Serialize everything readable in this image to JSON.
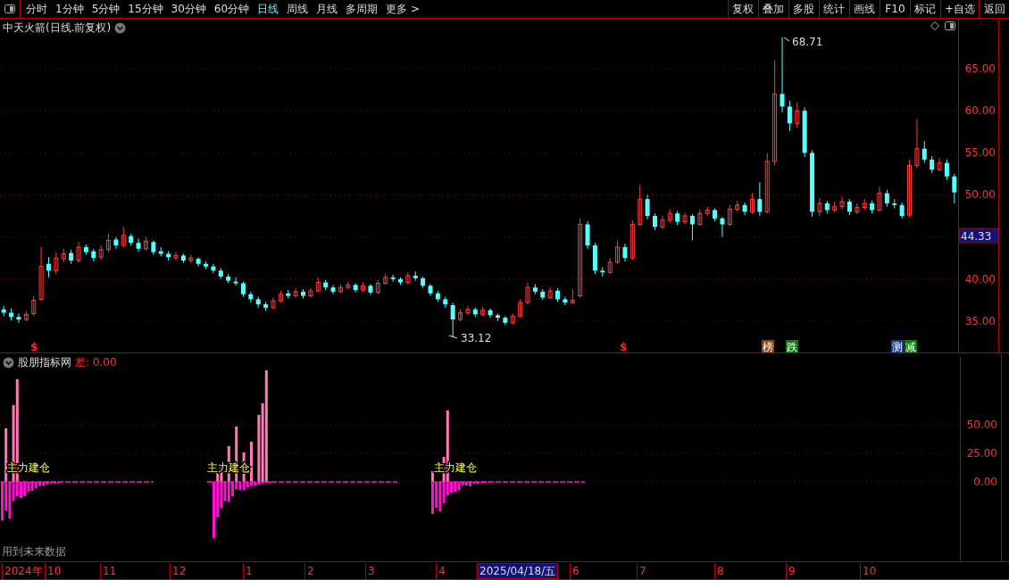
{
  "toolbar": {
    "periods": [
      {
        "label": "分时",
        "selected": false
      },
      {
        "label": "1分钟",
        "selected": false
      },
      {
        "label": "5分钟",
        "selected": false
      },
      {
        "label": "15分钟",
        "selected": false
      },
      {
        "label": "30分钟",
        "selected": false
      },
      {
        "label": "60分钟",
        "selected": false
      },
      {
        "label": "日线",
        "selected": true
      },
      {
        "label": "周线",
        "selected": false
      },
      {
        "label": "月线",
        "selected": false
      },
      {
        "label": "多周期",
        "selected": false
      },
      {
        "label": "更多 >",
        "selected": false
      }
    ],
    "buttons": [
      "复权",
      "叠加",
      "多股",
      "统计",
      "画线",
      "F10",
      "标记",
      "+自选",
      "返回"
    ]
  },
  "main_chart": {
    "title": "中天火箭(日线.前复权)",
    "chart_data": {
      "type": "candlestick",
      "ylim": [
        31.17,
        70.94
      ],
      "grid": true,
      "yticks": [
        {
          "value": 65,
          "label": "65.00"
        },
        {
          "value": 60,
          "label": "60.00"
        },
        {
          "value": 55,
          "label": "55.00"
        },
        {
          "value": 50,
          "label": "50.00"
        },
        {
          "value": 40,
          "label": "40.00"
        },
        {
          "value": 35,
          "label": "35.00"
        }
      ],
      "ohlc": [
        [
          36.4,
          36.8,
          35.6,
          36.0
        ],
        [
          36.0,
          36.5,
          35.1,
          35.5
        ],
        [
          35.5,
          35.9,
          34.8,
          35.2
        ],
        [
          35.2,
          36.2,
          35.0,
          35.8
        ],
        [
          35.9,
          38.0,
          35.6,
          37.5
        ],
        [
          37.6,
          43.8,
          37.4,
          41.5
        ],
        [
          41.8,
          42.6,
          40.2,
          41.0
        ],
        [
          41.0,
          43.2,
          40.6,
          42.5
        ],
        [
          42.4,
          43.6,
          42.0,
          43.0
        ],
        [
          43.1,
          43.5,
          41.8,
          42.2
        ],
        [
          42.2,
          44.4,
          42.0,
          43.8
        ],
        [
          43.8,
          44.1,
          42.9,
          43.2
        ],
        [
          43.3,
          43.6,
          42.1,
          42.5
        ],
        [
          42.6,
          44.0,
          42.3,
          43.5
        ],
        [
          43.5,
          45.4,
          43.2,
          44.6
        ],
        [
          44.7,
          45.0,
          43.6,
          44.0
        ],
        [
          44.0,
          46.2,
          43.8,
          45.2
        ],
        [
          45.1,
          45.4,
          44.0,
          44.3
        ],
        [
          44.3,
          44.8,
          43.2,
          43.6
        ],
        [
          43.6,
          45.0,
          43.4,
          44.5
        ],
        [
          44.4,
          44.6,
          42.9,
          43.2
        ],
        [
          43.3,
          43.8,
          42.7,
          43.0
        ],
        [
          43.0,
          43.3,
          42.2,
          42.6
        ],
        [
          42.5,
          43.2,
          42.2,
          42.8
        ],
        [
          42.8,
          43.0,
          41.9,
          42.2
        ],
        [
          42.2,
          42.9,
          41.9,
          42.5
        ],
        [
          42.4,
          42.6,
          41.5,
          41.8
        ],
        [
          41.8,
          42.1,
          41.2,
          41.5
        ],
        [
          41.5,
          41.8,
          40.7,
          41.0
        ],
        [
          41.0,
          41.3,
          40.0,
          40.3
        ],
        [
          40.3,
          40.6,
          39.5,
          39.8
        ],
        [
          39.7,
          40.2,
          39.2,
          39.5
        ],
        [
          39.5,
          39.7,
          37.9,
          38.2
        ],
        [
          38.2,
          38.5,
          37.2,
          37.6
        ],
        [
          37.6,
          37.9,
          36.6,
          37.0
        ],
        [
          37.0,
          37.3,
          36.2,
          36.6
        ],
        [
          36.6,
          37.8,
          36.4,
          37.4
        ],
        [
          37.4,
          38.6,
          37.2,
          38.2
        ],
        [
          38.3,
          38.7,
          37.7,
          38.0
        ],
        [
          38.0,
          38.9,
          37.8,
          38.5
        ],
        [
          38.5,
          38.8,
          37.7,
          38.0
        ],
        [
          38.0,
          38.9,
          37.8,
          38.6
        ],
        [
          38.6,
          40.2,
          38.4,
          39.6
        ],
        [
          39.6,
          39.9,
          38.7,
          39.0
        ],
        [
          39.0,
          39.3,
          38.2,
          38.5
        ],
        [
          38.5,
          39.4,
          38.3,
          39.0
        ],
        [
          39.0,
          39.7,
          38.8,
          39.3
        ],
        [
          39.3,
          39.5,
          38.4,
          38.7
        ],
        [
          38.7,
          39.6,
          38.5,
          39.2
        ],
        [
          39.2,
          39.4,
          38.1,
          38.4
        ],
        [
          38.4,
          39.9,
          38.2,
          39.5
        ],
        [
          39.5,
          40.6,
          39.3,
          40.2
        ],
        [
          40.2,
          40.5,
          39.7,
          40.0
        ],
        [
          40.0,
          40.2,
          39.3,
          39.6
        ],
        [
          39.6,
          40.8,
          39.4,
          40.4
        ],
        [
          40.4,
          40.9,
          39.8,
          40.1
        ],
        [
          40.1,
          40.3,
          38.9,
          39.2
        ],
        [
          39.2,
          39.4,
          38.0,
          38.3
        ],
        [
          38.3,
          38.6,
          37.3,
          37.6
        ],
        [
          37.6,
          37.9,
          36.6,
          37.0
        ],
        [
          36.9,
          37.2,
          33.12,
          35.2
        ],
        [
          35.2,
          36.4,
          35.0,
          36.0
        ],
        [
          36.0,
          36.8,
          35.7,
          36.4
        ],
        [
          36.4,
          36.6,
          35.5,
          35.8
        ],
        [
          35.8,
          36.7,
          35.6,
          36.3
        ],
        [
          36.3,
          36.5,
          35.4,
          35.7
        ],
        [
          35.7,
          35.9,
          35.0,
          35.4
        ],
        [
          35.4,
          35.6,
          34.5,
          34.8
        ],
        [
          34.8,
          35.9,
          34.6,
          35.6
        ],
        [
          35.6,
          37.6,
          35.4,
          37.2
        ],
        [
          37.2,
          39.6,
          37.0,
          39.0
        ],
        [
          39.0,
          39.4,
          38.2,
          38.5
        ],
        [
          38.5,
          38.8,
          37.5,
          37.8
        ],
        [
          37.8,
          39.0,
          37.6,
          38.6
        ],
        [
          38.6,
          38.9,
          37.3,
          37.6
        ],
        [
          37.6,
          37.9,
          36.9,
          37.2
        ],
        [
          37.2,
          38.8,
          37.0,
          37.5
        ],
        [
          38.0,
          47.2,
          37.8,
          46.5
        ],
        [
          46.5,
          46.9,
          43.6,
          44.0
        ],
        [
          44.0,
          44.3,
          40.6,
          41.0
        ],
        [
          41.0,
          41.4,
          40.3,
          40.8
        ],
        [
          40.8,
          42.5,
          40.6,
          42.0
        ],
        [
          42.0,
          44.6,
          41.8,
          43.8
        ],
        [
          43.8,
          44.2,
          42.1,
          42.5
        ],
        [
          42.5,
          47.0,
          42.3,
          46.5
        ],
        [
          46.5,
          51.2,
          46.3,
          49.5
        ],
        [
          49.5,
          50.0,
          47.1,
          47.5
        ],
        [
          47.5,
          47.8,
          45.8,
          46.2
        ],
        [
          46.2,
          47.5,
          45.9,
          47.0
        ],
        [
          47.0,
          48.3,
          46.7,
          47.8
        ],
        [
          47.8,
          48.1,
          46.4,
          46.8
        ],
        [
          46.8,
          47.9,
          46.5,
          47.5
        ],
        [
          47.5,
          47.7,
          44.6,
          46.5
        ],
        [
          46.5,
          48.3,
          46.3,
          47.8
        ],
        [
          47.8,
          48.6,
          47.5,
          48.2
        ],
        [
          48.2,
          48.4,
          46.9,
          47.2
        ],
        [
          47.2,
          47.4,
          45.0,
          46.5
        ],
        [
          46.5,
          48.8,
          46.3,
          48.3
        ],
        [
          48.3,
          49.3,
          48.0,
          48.8
        ],
        [
          48.8,
          49.1,
          47.6,
          48.0
        ],
        [
          48.0,
          50.2,
          47.8,
          49.5
        ],
        [
          49.5,
          51.5,
          47.5,
          48.0
        ],
        [
          48.0,
          55.0,
          47.8,
          54.0
        ],
        [
          54.0,
          66.0,
          53.5,
          62.0
        ],
        [
          62.0,
          68.71,
          59.8,
          60.5
        ],
        [
          60.5,
          61.2,
          57.6,
          58.5
        ],
        [
          58.5,
          61.0,
          58.0,
          60.0
        ],
        [
          60.0,
          60.4,
          54.5,
          55.0
        ],
        [
          55.0,
          55.3,
          47.4,
          48.0
        ],
        [
          48.0,
          49.6,
          47.5,
          49.0
        ],
        [
          49.0,
          49.3,
          47.8,
          48.2
        ],
        [
          48.2,
          49.2,
          47.9,
          48.6
        ],
        [
          48.6,
          49.8,
          48.3,
          49.2
        ],
        [
          49.2,
          49.5,
          47.6,
          48.0
        ],
        [
          48.0,
          49.0,
          47.7,
          48.5
        ],
        [
          48.5,
          49.5,
          48.2,
          49.0
        ],
        [
          49.0,
          49.3,
          47.8,
          48.2
        ],
        [
          48.2,
          51.0,
          48.0,
          50.2
        ],
        [
          50.2,
          50.6,
          48.6,
          49.0
        ],
        [
          49.0,
          49.5,
          48.4,
          48.8
        ],
        [
          48.8,
          49.1,
          47.2,
          47.5
        ],
        [
          47.6,
          54.2,
          47.4,
          53.5
        ],
        [
          53.5,
          59.0,
          53.2,
          55.5
        ],
        [
          55.5,
          56.4,
          53.8,
          54.2
        ],
        [
          54.2,
          54.6,
          52.6,
          53.0
        ],
        [
          53.0,
          54.4,
          52.8,
          53.8
        ],
        [
          53.8,
          54.2,
          51.8,
          52.2
        ],
        [
          52.2,
          52.5,
          49.0,
          50.3
        ]
      ]
    },
    "current_price": "44.33",
    "high_label": "68.71",
    "low_label": "33.12",
    "event_marks": [
      {
        "label": "$",
        "color": "#ff2020"
      },
      {
        "label": "$",
        "color": "#ff2020"
      }
    ],
    "badges": [
      {
        "label": "榜",
        "color": "#8b4a10"
      },
      {
        "label": "跌",
        "color": "#107a10"
      },
      {
        "label": "测",
        "color": "#1a3f8a"
      },
      {
        "label": "减",
        "color": "#107a10"
      }
    ]
  },
  "indicator": {
    "title": "股朋指标网",
    "value": "差: 0.00",
    "signal_labels": [
      "主力建仓",
      "主力建仓",
      "主力建仓"
    ],
    "axis_labels": [
      "50.00",
      "25.00",
      "0.00"
    ],
    "note": "用到未来数据"
  },
  "time_axis": {
    "labels": [
      "2024年",
      "10",
      "11",
      "12",
      "1",
      "2",
      "3",
      "4",
      "6",
      "7",
      "8",
      "9",
      "10"
    ],
    "cursor_date": "2025/04/18/五"
  }
}
